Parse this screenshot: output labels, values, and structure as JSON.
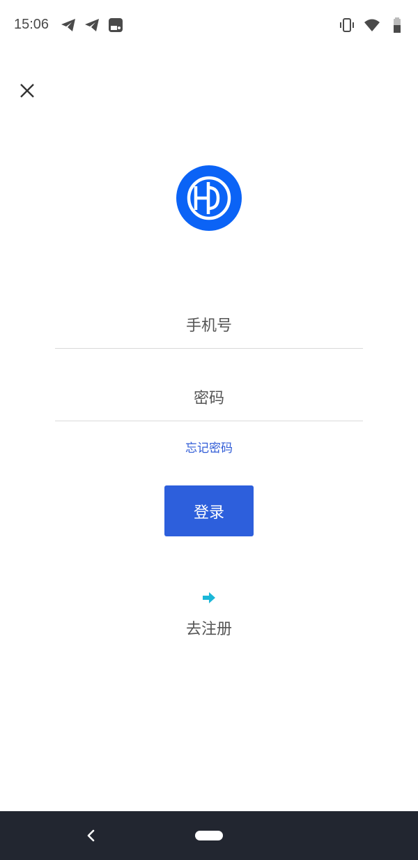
{
  "status_bar": {
    "time": "15:06",
    "left_icons": [
      "telegram-icon",
      "telegram-icon",
      "notification-icon"
    ],
    "right_icons": [
      "vibrate-icon",
      "wifi-icon",
      "battery-icon"
    ]
  },
  "header": {
    "close_icon": "close-icon"
  },
  "logo": {
    "icon": "hd-logo-icon",
    "color": "#0b63f6"
  },
  "form": {
    "phone_placeholder": "手机号",
    "password_placeholder": "密码",
    "forgot_label": "忘记密码",
    "login_label": "登录"
  },
  "register": {
    "icon": "arrow-right-icon",
    "label": "去注册",
    "icon_color": "#1bb7d8"
  },
  "nav_bar": {
    "back_icon": "back-icon",
    "home_icon": "home-pill-icon"
  },
  "colors": {
    "primary": "#2d5fdc",
    "link": "#2f5bd6",
    "nav_bg": "#222630"
  }
}
